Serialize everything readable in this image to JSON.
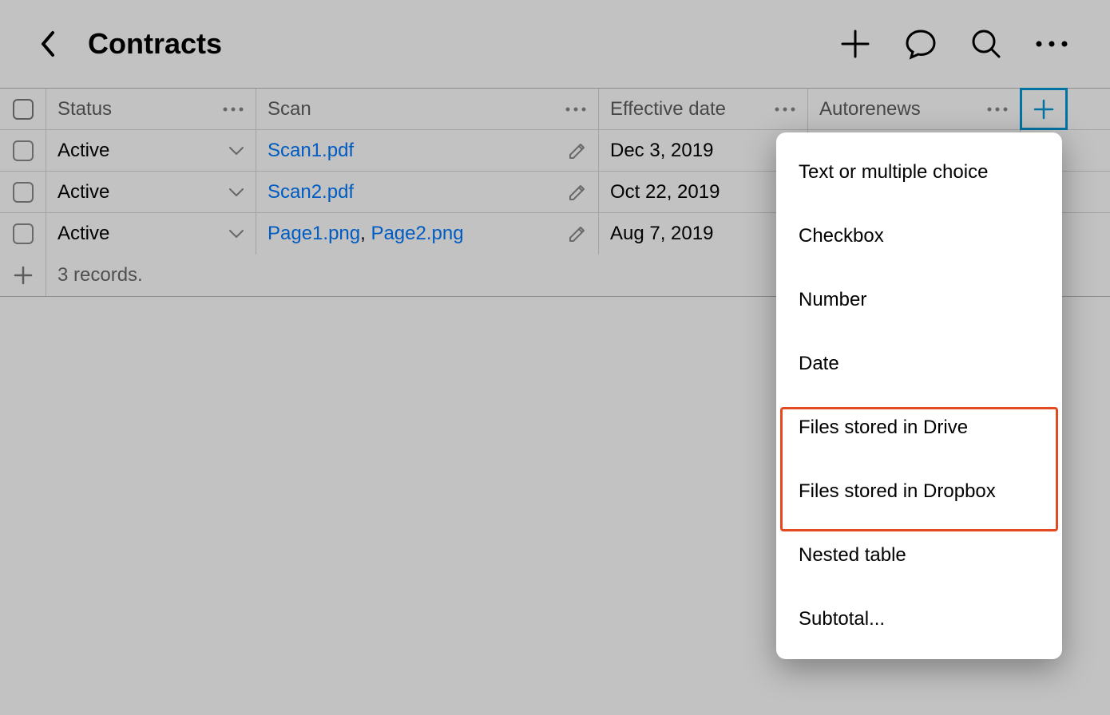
{
  "header": {
    "title": "Contracts"
  },
  "columns": {
    "status": "Status",
    "scan": "Scan",
    "effective_date": "Effective date",
    "autorenews": "Autorenews"
  },
  "rows": [
    {
      "status": "Active",
      "scans": [
        "Scan1.pdf"
      ],
      "effective_date": "Dec 3, 2019"
    },
    {
      "status": "Active",
      "scans": [
        "Scan2.pdf"
      ],
      "effective_date": "Oct 22, 2019"
    },
    {
      "status": "Active",
      "scans": [
        "Page1.png",
        "Page2.png"
      ],
      "effective_date": "Aug 7, 2019"
    }
  ],
  "footer": {
    "summary": "3 records."
  },
  "dropdown": {
    "items": [
      "Text or multiple choice",
      "Checkbox",
      "Number",
      "Date",
      "Files stored in Drive",
      "Files stored in Dropbox",
      "Nested table",
      "Subtotal..."
    ]
  },
  "colors": {
    "link": "#007aff",
    "highlight": "#0098d6",
    "annotation": "#e34a1f"
  }
}
